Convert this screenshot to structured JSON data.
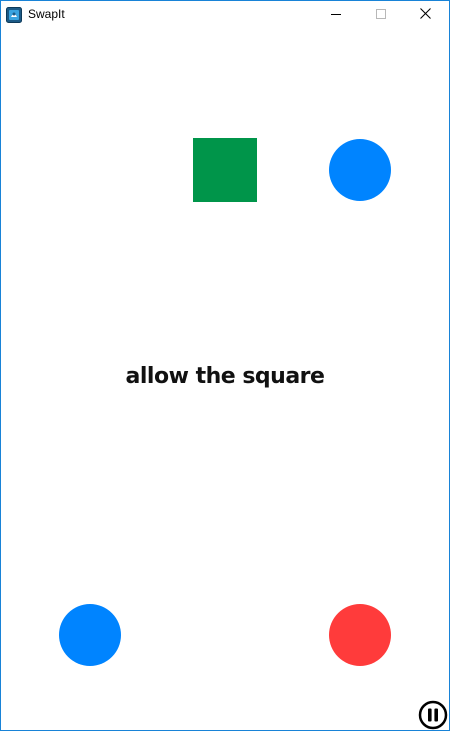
{
  "window": {
    "title": "SwapIt",
    "app_icon": "app-icon",
    "controls": [
      "minimize-icon",
      "maximize-icon",
      "close-icon"
    ]
  },
  "game": {
    "hint_text": "allow the square",
    "shapes": [
      {
        "kind": "square",
        "color": "#00954a"
      },
      {
        "kind": "circle",
        "color": "#0084ff"
      },
      {
        "kind": "circle",
        "color": "#0084ff"
      },
      {
        "kind": "circle",
        "color": "#ff3b3b"
      }
    ],
    "pause_icon": "pause-icon"
  }
}
